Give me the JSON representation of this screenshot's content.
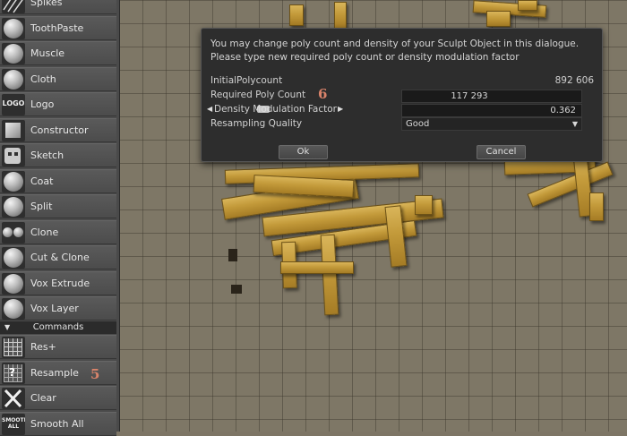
{
  "tools": [
    {
      "label": "Spikes",
      "icon": "spikes-icon"
    },
    {
      "label": "ToothPaste",
      "icon": "toothpaste-icon"
    },
    {
      "label": "Muscle",
      "icon": "muscle-icon"
    },
    {
      "label": "Cloth",
      "icon": "cloth-icon"
    },
    {
      "label": "Logo",
      "icon": "logo-icon",
      "icon_text": "LOGO"
    },
    {
      "label": "Constructor",
      "icon": "constructor-icon"
    },
    {
      "label": "Sketch",
      "icon": "sketch-icon"
    },
    {
      "label": "Coat",
      "icon": "coat-icon"
    },
    {
      "label": "Split",
      "icon": "split-icon"
    },
    {
      "label": "Clone",
      "icon": "clone-icon"
    },
    {
      "label": "Cut & Clone",
      "icon": "cut-clone-icon"
    },
    {
      "label": "Vox Extrude",
      "icon": "vox-extrude-icon"
    },
    {
      "label": "Vox Layer",
      "icon": "vox-layer-icon"
    }
  ],
  "commands_header": "Commands",
  "commands": [
    {
      "label": "Res+",
      "icon": "res-plus-icon"
    },
    {
      "label": "Resample",
      "icon": "resample-icon",
      "icon_text": "?"
    },
    {
      "label": "Clear",
      "icon": "clear-icon"
    },
    {
      "label": "Smooth  All",
      "icon": "smooth-all-icon",
      "icon_text": "SMOOTH ALL"
    }
  ],
  "badges": {
    "resample": "5",
    "poly_count": "6"
  },
  "dialog": {
    "message": "You may change poly count and density of your Sculpt Object in this dialogue.\nPlease type new required poly count or density modulation factor",
    "initial_polycount_label": "InitialPolycount",
    "initial_polycount_value": "892 606",
    "required_poly_label": "Required Poly Count",
    "required_poly_value": "117 293",
    "density_label": "Density Modulation Factor",
    "density_value": "0.362",
    "quality_label": "Resampling Quality",
    "quality_value": "Good",
    "ok_label": "Ok",
    "cancel_label": "Cancel"
  },
  "colors": {
    "badge": "#d9836a",
    "panel": "#4a4a4a",
    "dialog": "#2d2d2d",
    "plank": "#c39a3a"
  }
}
